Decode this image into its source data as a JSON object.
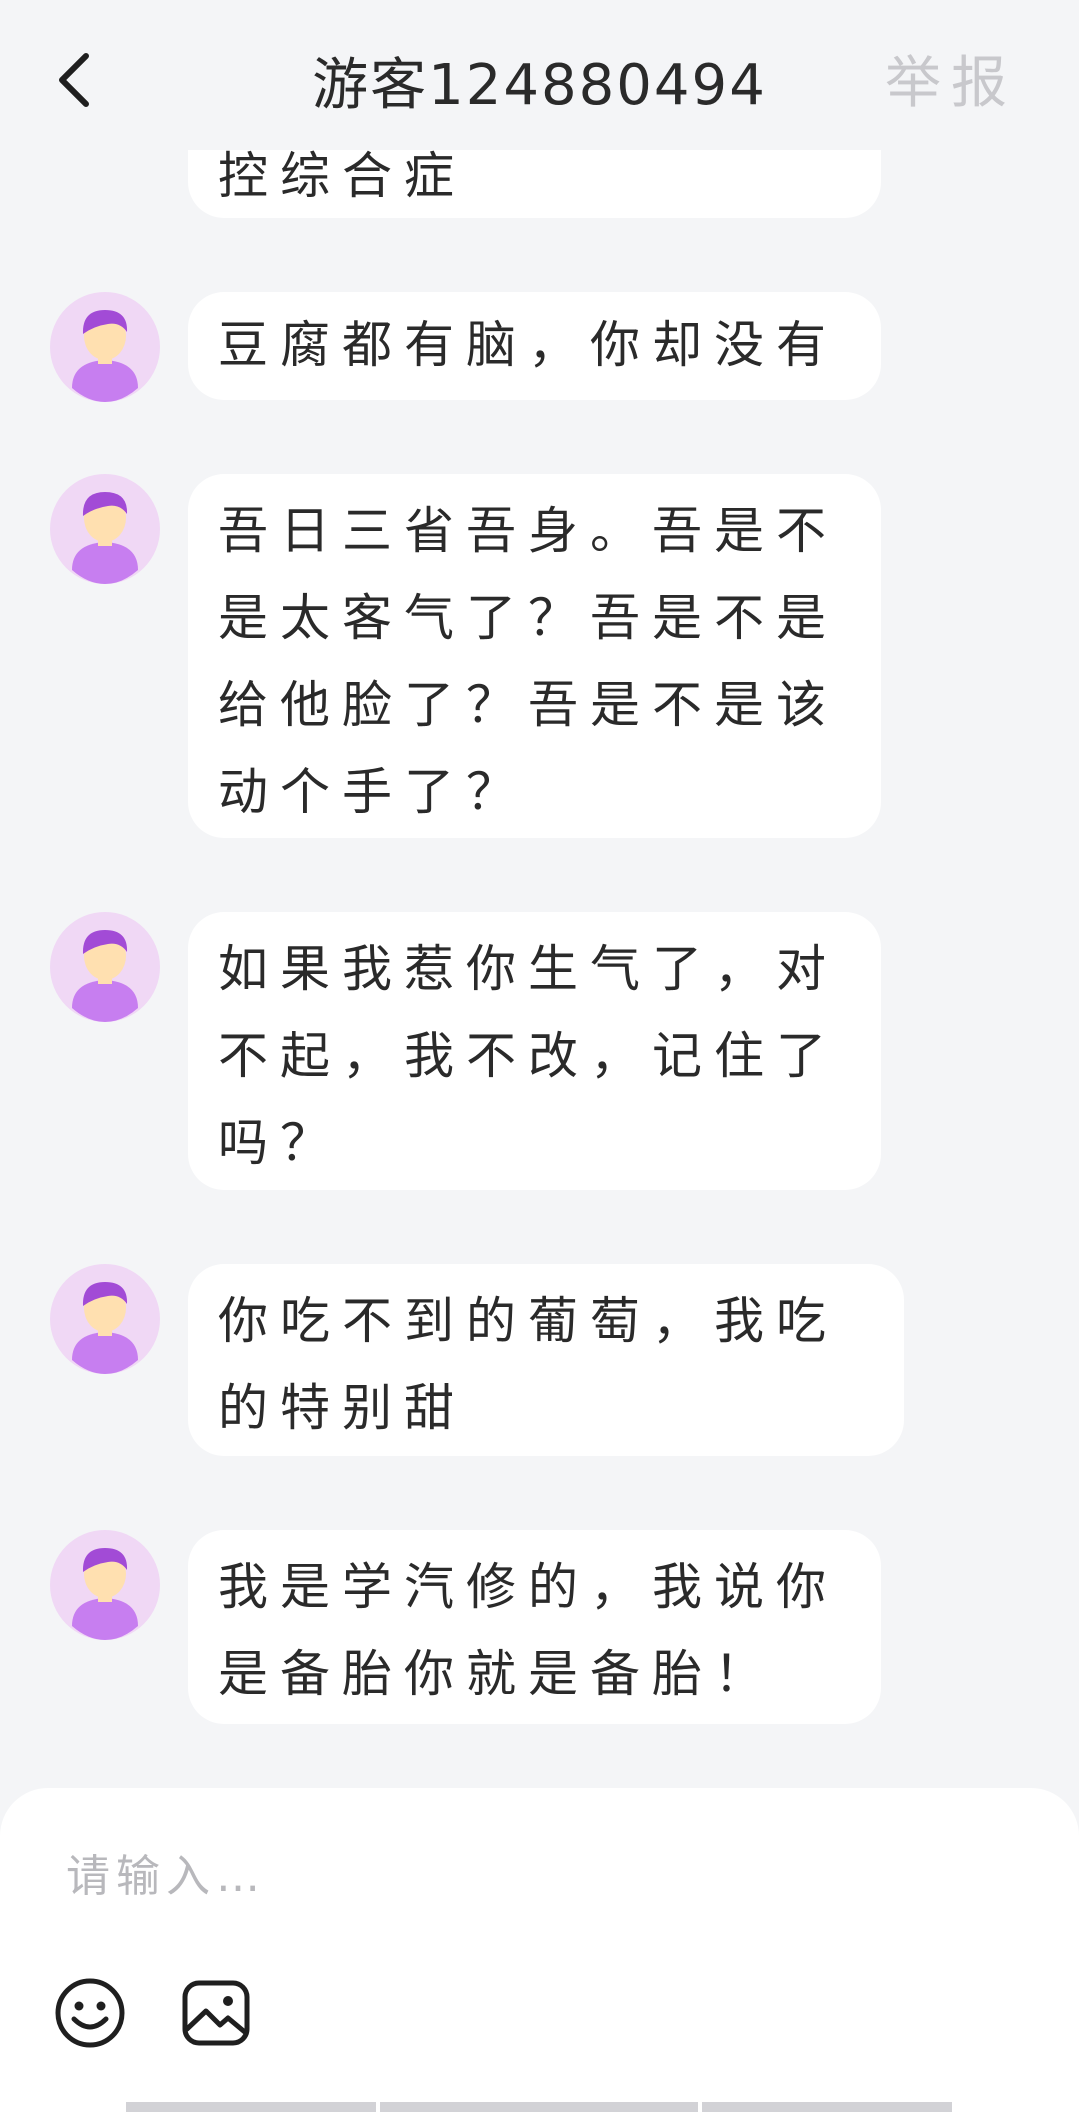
{
  "header": {
    "title": "游客124880494",
    "report_label": "举报",
    "back_icon": "chevron-left-icon"
  },
  "messages": [
    {
      "text": "控综合症",
      "avatar": "avatar-icon"
    },
    {
      "text": "豆腐都有脑，你却没有",
      "avatar": "avatar-icon"
    },
    {
      "text": "吾日三省吾身。吾是不是太客气了？吾是不是给他脸了？吾是不是该动个手了？",
      "avatar": "avatar-icon"
    },
    {
      "text": "如果我惹你生气了，对不起，我不改，记住了吗？",
      "avatar": "avatar-icon"
    },
    {
      "text": "你吃不到的葡萄，我吃的特别甜",
      "avatar": "avatar-icon"
    },
    {
      "text": "我是学汽修的，我说你是备胎你就是备胎！",
      "avatar": "avatar-icon"
    }
  ],
  "composer": {
    "placeholder": "请输入…",
    "emoji_icon": "smiley-icon",
    "image_icon": "image-icon"
  },
  "colors": {
    "background": "#f4f5f7",
    "bubble": "#ffffff",
    "avatar_bg": "#f0d8f5",
    "avatar_body": "#c77ef0",
    "avatar_hair": "#a24bd6",
    "avatar_face": "#ffe0b0"
  }
}
